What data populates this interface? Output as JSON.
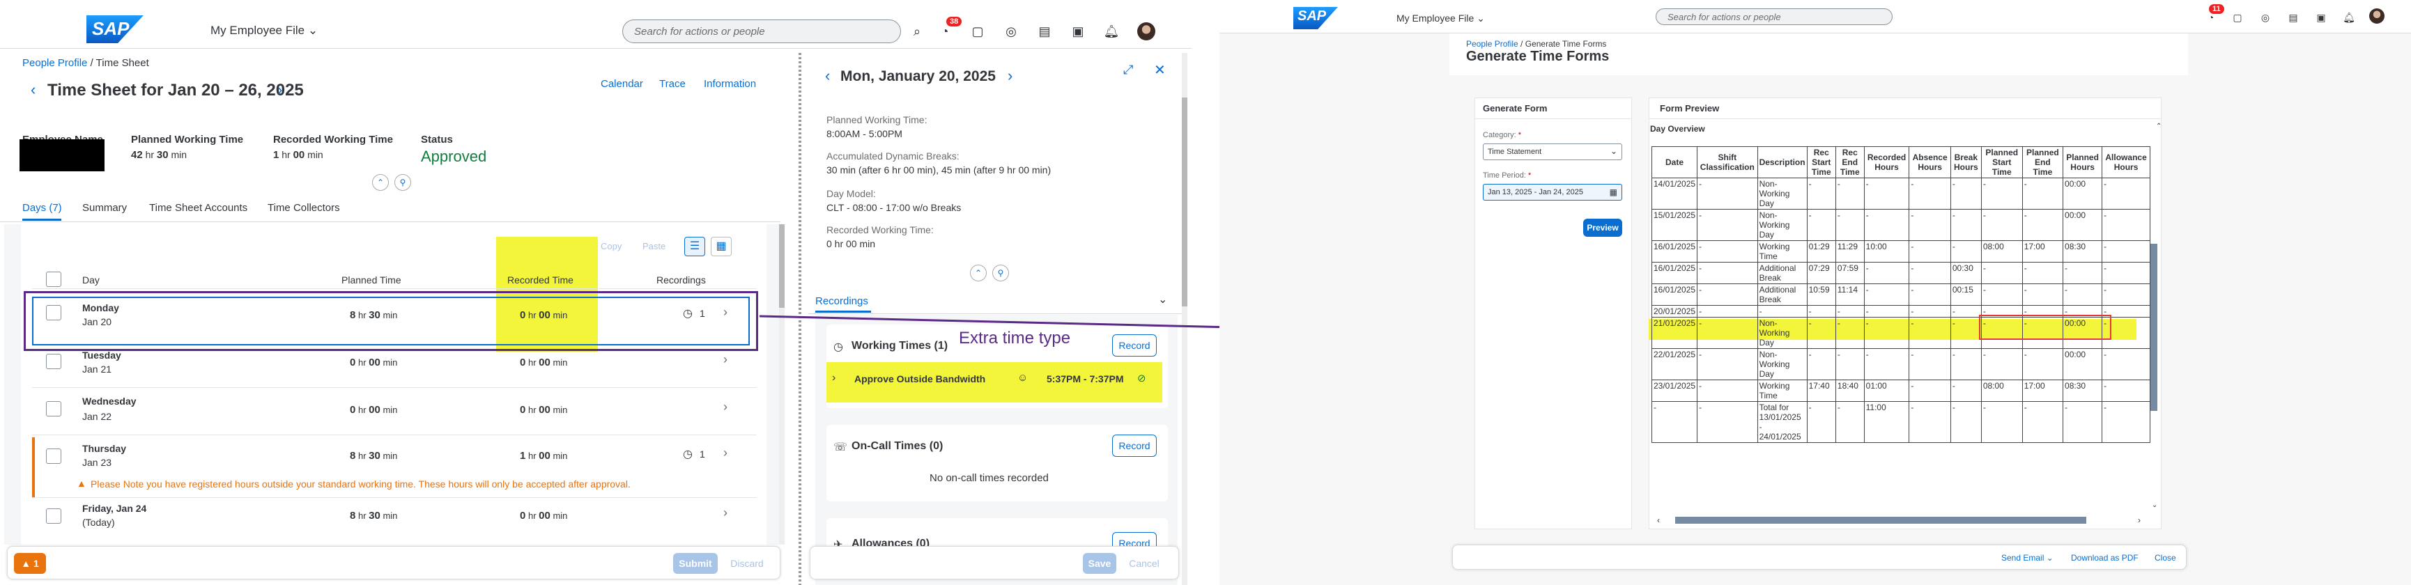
{
  "left": {
    "shell": {
      "logo": "SAP",
      "title": "My Employee File",
      "search_placeholder": "Search for actions or people",
      "notif_badge": "38"
    },
    "breadcrumb": {
      "root": "People Profile",
      "current": "Time Sheet"
    },
    "page_title": "Time Sheet for Jan 20 – 26, 2025",
    "header_links": [
      "Calendar",
      "Trace",
      "Information"
    ],
    "summary": {
      "employee_label": "Employee Name",
      "planned_label": "Planned Working Time",
      "planned_hr": "42",
      "planned_min": "30",
      "recorded_label": "Recorded Working Time",
      "recorded_hr": "1",
      "recorded_min": "00",
      "status_label": "Status",
      "status_value": "Approved"
    },
    "tabs": [
      "Days (7)",
      "Summary",
      "Time Sheet Accounts",
      "Time Collectors"
    ],
    "toolbar": {
      "copy": "Copy",
      "paste": "Paste"
    },
    "columns": {
      "day": "Day",
      "planned": "Planned Time",
      "recorded": "Recorded Time",
      "recordings": "Recordings"
    },
    "units": {
      "hr": "hr",
      "min": "min"
    },
    "rows": [
      {
        "day": "Monday",
        "date": "Jan 20",
        "p_hr": "8",
        "p_min": "30",
        "r_hr": "0",
        "r_min": "00",
        "rec": "1"
      },
      {
        "day": "Tuesday",
        "date": "Jan 21",
        "p_hr": "0",
        "p_min": "00",
        "r_hr": "0",
        "r_min": "00",
        "rec": ""
      },
      {
        "day": "Wednesday",
        "date": "Jan 22",
        "p_hr": "0",
        "p_min": "00",
        "r_hr": "0",
        "r_min": "00",
        "rec": ""
      },
      {
        "day": "Thursday",
        "date": "Jan 23",
        "p_hr": "8",
        "p_min": "30",
        "r_hr": "1",
        "r_min": "00",
        "rec": "1"
      },
      {
        "day": "Friday, Jan 24",
        "date": "(Today)",
        "p_hr": "8",
        "p_min": "30",
        "r_hr": "0",
        "r_min": "00",
        "rec": ""
      }
    ],
    "warning": "Please Note you have registered hours outside your standard working time. These hours will only be accepted after approval.",
    "footer": {
      "msg_count": "1",
      "submit": "Submit",
      "discard": "Discard"
    },
    "detail": {
      "title": "Mon, January 20, 2025",
      "planned_label": "Planned Working Time:",
      "planned_value": "8:00AM - 5:00PM",
      "breaks_label": "Accumulated Dynamic Breaks:",
      "breaks_value": "30 min (after 6 hr 00 min), 45 min (after 9 hr 00 min)",
      "model_label": "Day Model:",
      "model_value": "CLT - 08:00 - 17:00 w/o Breaks",
      "recorded_label": "Recorded Working Time:",
      "recorded_value": "0 hr 00 min",
      "recordings_tab": "Recordings",
      "working_times": "Working Times (1)",
      "record": "Record",
      "entry_name": "Approve Outside Bandwidth",
      "entry_time": "5:37PM - 7:37PM",
      "oncall": "On-Call Times (0)",
      "no_oncall": "No on-call times recorded",
      "allowances": "Allowances (0)",
      "save": "Save",
      "cancel": "Cancel"
    },
    "annotation": "Extra time type"
  },
  "right": {
    "shell": {
      "logo": "SAP",
      "title": "My Employee File",
      "search_placeholder": "Search for actions or people",
      "notif_badge": "11"
    },
    "breadcrumb": {
      "root": "People Profile",
      "current": "Generate Time Forms"
    },
    "page_title": "Generate Time Forms",
    "form": {
      "title": "Generate Form",
      "category_label": "Category:",
      "category_value": "Time Statement",
      "period_label": "Time Period:",
      "period_value": "Jan 13, 2025 - Jan 24, 2025",
      "preview_btn": "Preview"
    },
    "preview": {
      "title": "Form Preview",
      "overview": "Day Overview",
      "headers": [
        "Date",
        "Shift Classification",
        "Description",
        "Rec Start Time",
        "Rec End Time",
        "Recorded Hours",
        "Absence Hours",
        "Break Hours",
        "Planned Start Time",
        "Planned End Time",
        "Planned Hours",
        "Allowance Hours"
      ],
      "rows": [
        [
          "14/01/2025",
          "-",
          "Non-Working Day",
          "-",
          "-",
          "-",
          "-",
          "-",
          "-",
          "-",
          "00:00",
          "-"
        ],
        [
          "15/01/2025",
          "-",
          "Non-Working Day",
          "-",
          "-",
          "-",
          "-",
          "-",
          "-",
          "-",
          "00:00",
          "-"
        ],
        [
          "16/01/2025",
          "-",
          "Working Time",
          "01:29",
          "11:29",
          "10:00",
          "-",
          "-",
          "08:00",
          "17:00",
          "08:30",
          "-"
        ],
        [
          "16/01/2025",
          "-",
          "Additional Break",
          "07:29",
          "07:59",
          "-",
          "-",
          "00:30",
          "-",
          "-",
          "-",
          "-"
        ],
        [
          "16/01/2025",
          "-",
          "Additional Break",
          "10:59",
          "11:14",
          "-",
          "-",
          "00:15",
          "-",
          "-",
          "-",
          "-"
        ],
        [
          "20/01/2025",
          "-",
          "-",
          "-",
          "-",
          "-",
          "-",
          "-",
          "-",
          "-",
          "-",
          "-"
        ],
        [
          "21/01/2025",
          "-",
          "Non-Working Day",
          "-",
          "-",
          "-",
          "-",
          "-",
          "-",
          "-",
          "00:00",
          "-"
        ],
        [
          "22/01/2025",
          "-",
          "Non-Working Day",
          "-",
          "-",
          "-",
          "-",
          "-",
          "-",
          "-",
          "00:00",
          "-"
        ],
        [
          "23/01/2025",
          "-",
          "Working Time",
          "17:40",
          "18:40",
          "01:00",
          "-",
          "-",
          "08:00",
          "17:00",
          "08:30",
          "-"
        ],
        [
          "-",
          "-",
          "Total for 13/01/2025 - 24/01/2025",
          "-",
          "-",
          "11:00",
          "-",
          "-",
          "-",
          "-",
          "-",
          "-"
        ]
      ]
    },
    "footer": {
      "send_email": "Send Email",
      "download": "Download as PDF",
      "close": "Close"
    }
  },
  "colors": {
    "accent": "#0a6ed1",
    "highlight": "#f2f53a",
    "annotation": "#5b2a86",
    "approved": "#107e3e",
    "warning": "#e9730c"
  }
}
